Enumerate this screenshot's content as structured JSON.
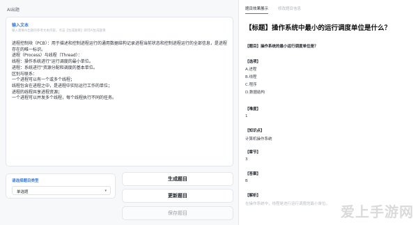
{
  "left_panel": {
    "tab_label": "AI出题",
    "input_card": {
      "title": "输入文本",
      "hint": "输入需要AI出题的参考文本内容，点击【生成题目】即可AI生成题目",
      "text": "进程控制块（PCB）：用于描述和控制进程运行的通用数据结构记录进程当前状态和控制进程运行的全部信息，是进程存在的唯一标识。\n进程（Process）与线程（Thread）：\n线程：操作系统进行\"运行调度的最小单位。\n进程：系统进行\"资源分配和调度的基本单位。\n区别与联系：\n一个进程可以有一个或多个线程；\n线程包含在进程之中，是进程中实际运行工作的单位；\n进程的线程共享进程资源；\n一个进程可以并发多个线程，每个线程执行不同的任务。"
    },
    "type_card": {
      "label": "请选择题目类型",
      "selected": "单选题"
    },
    "buttons": {
      "generate": "生成题目",
      "regenerate": "更新题目",
      "save": "保存题目"
    }
  },
  "right_panel": {
    "tabs": [
      "题目效果展示",
      "修改题目信息"
    ],
    "question_title": "【标题】操作系统中最小的运行调度单位是什么？",
    "stem": "【题目】操作系统的最小运行调度单位是？",
    "options_header": "【选项】",
    "options": [
      "A.进程",
      "B.线程",
      "C.程序",
      "D.数据结构"
    ],
    "difficulty_header": "【难度】",
    "difficulty_value": "1",
    "knowledge_header": "【知识点】",
    "knowledge_value": "计算机操作系统",
    "chapter_header": "【章节】",
    "chapter_value": "3",
    "answer_header": "【答案】",
    "answer_value": "B",
    "analysis_header": "【解析】",
    "analysis_value": "在操作系统中，线程是进行运行调度的最小单位。"
  },
  "watermark": "爱上手游网",
  "colors": {
    "accent": "#3a7bd5",
    "panel_bg": "#f7f8fa"
  }
}
